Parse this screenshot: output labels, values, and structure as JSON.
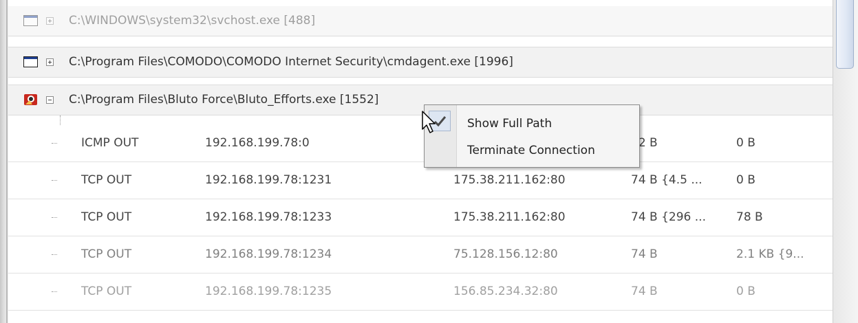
{
  "processes": [
    {
      "path": "C:\\WINDOWS\\system32\\svchost.exe [488]",
      "icon": "window-app-icon",
      "expanded": false
    },
    {
      "path": "C:\\Program Files\\COMODO\\COMODO Internet Security\\cmdagent.exe [1996]",
      "icon": "window-app-icon",
      "expanded": false
    },
    {
      "path": "C:\\Program Files\\Bluto Force\\Bluto_Efforts.exe [1552]",
      "icon": "red-app-icon",
      "expanded": true
    }
  ],
  "connections": [
    {
      "protocol": "ICMP OUT",
      "source": "192.168.199.78:0",
      "destination": "",
      "sent": "02 B",
      "received": "0 B"
    },
    {
      "protocol": "TCP OUT",
      "source": "192.168.199.78:1231",
      "destination": "175.38.211.162:80",
      "sent": "74 B {4.5 ...",
      "received": "0 B"
    },
    {
      "protocol": "TCP OUT",
      "source": "192.168.199.78:1233",
      "destination": "175.38.211.162:80",
      "sent": "74 B {296 ...",
      "received": "78 B"
    },
    {
      "protocol": "TCP OUT",
      "source": "192.168.199.78:1234",
      "destination": "75.128.156.12:80",
      "sent": "74 B",
      "received": "2.1 KB {9..."
    },
    {
      "protocol": "TCP OUT",
      "source": "192.168.199.78:1235",
      "destination": "156.85.234.32:80",
      "sent": "74 B",
      "received": "0 B"
    }
  ],
  "context_menu": {
    "items": [
      {
        "label": "Show Full Path",
        "checked": true
      },
      {
        "label": "Terminate Connection",
        "checked": false
      }
    ]
  },
  "colors": {
    "selected_row_bg": "#f2f2f2",
    "menu_bg": "#f5f5f5",
    "scroll_thumb": "#dfe7f4"
  }
}
